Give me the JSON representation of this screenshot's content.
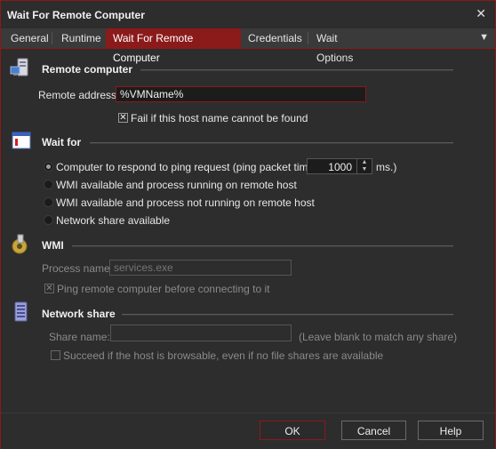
{
  "window": {
    "title": "Wait For Remote Computer",
    "close_glyph": "✕"
  },
  "tabs": [
    {
      "label": "General"
    },
    {
      "label": "Runtime"
    },
    {
      "label": "Wait For Remote Computer",
      "active": true
    },
    {
      "label": "Credentials"
    },
    {
      "label": "Wait Options"
    }
  ],
  "tab_menu_glyph": "▼",
  "remote": {
    "title": "Remote computer",
    "icon": "remote-computer-icon",
    "address_label": "Remote address:",
    "address_value": "%VMName%",
    "fail_checkbox_label": "Fail if this host name cannot be found",
    "fail_checked": true
  },
  "wait_for": {
    "title": "Wait for",
    "icon": "window-icon",
    "options": [
      {
        "label": "Computer to respond to ping request (ping packet timeout",
        "checked": true
      },
      {
        "label": "WMI available and process running on remote host",
        "checked": false
      },
      {
        "label": "WMI available and process not running on remote host",
        "checked": false
      },
      {
        "label": "Network share available",
        "checked": false
      }
    ],
    "timeout_value": "1000",
    "timeout_unit": "ms.)"
  },
  "wmi": {
    "title": "WMI",
    "icon": "gear-icon",
    "process_label": "Process name:",
    "process_placeholder": "services.exe",
    "ping_checkbox_label": "Ping remote computer before connecting to it",
    "ping_checked": true
  },
  "network_share": {
    "title": "Network share",
    "icon": "server-icon",
    "share_label": "Share name:",
    "share_value": "",
    "share_hint": "(Leave blank to match any share)",
    "succeed_checkbox_label": "Succeed if the host is browsable, even if no file shares are available",
    "succeed_checked": false
  },
  "buttons": {
    "ok": "OK",
    "cancel": "Cancel",
    "help": "Help"
  },
  "colors": {
    "accent": "#8b1a1a",
    "background": "#2d2d2d"
  }
}
